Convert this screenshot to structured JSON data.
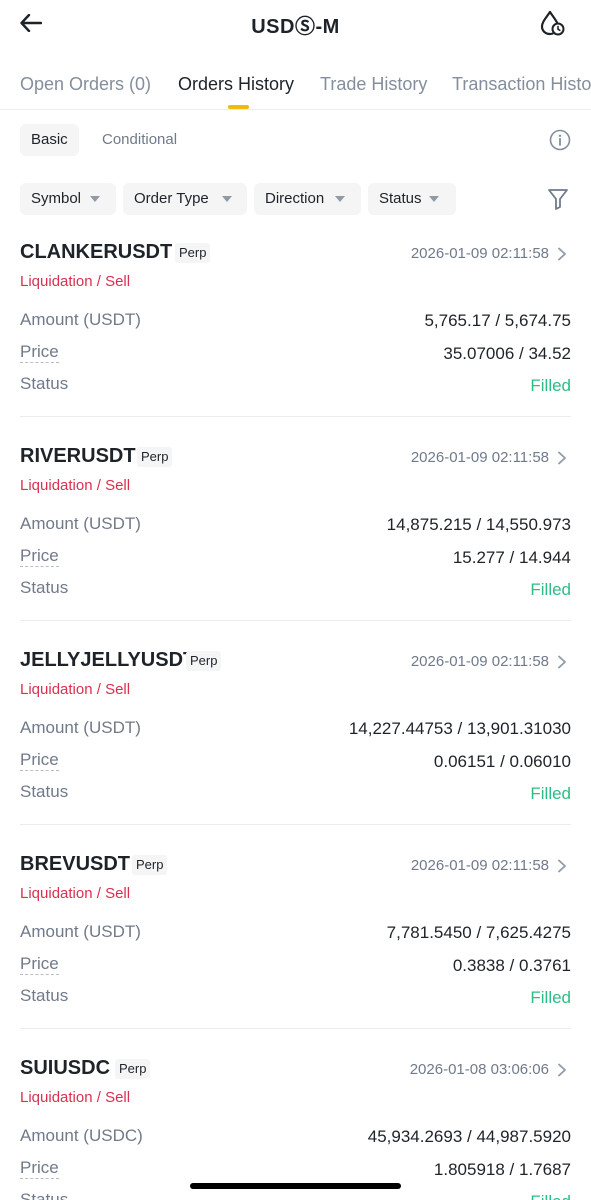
{
  "header": {
    "title": "USDⓈ-M",
    "back_icon": "arrow-left-icon",
    "right_icon": "drop-clock-icon"
  },
  "tabs": [
    {
      "label": "Open Orders (0)",
      "active": false
    },
    {
      "label": "Orders History",
      "active": true
    },
    {
      "label": "Trade History",
      "active": false
    },
    {
      "label": "Transaction History",
      "active": false
    }
  ],
  "subtabs": [
    {
      "label": "Basic",
      "active": true
    },
    {
      "label": "Conditional",
      "active": false
    }
  ],
  "filters": [
    {
      "label": "Symbol"
    },
    {
      "label": "Order Type"
    },
    {
      "label": "Direction"
    },
    {
      "label": "Status"
    }
  ],
  "orders": [
    {
      "symbol": "CLANKERUSDT",
      "badge": "Perp",
      "time": "2026-01-09 02:11:58",
      "type": "Liquidation / Sell",
      "amount_label": "Amount (USDT)",
      "amount": "5,765.17 / 5,674.75",
      "price_label": "Price",
      "price": "35.07006 / 34.52",
      "status_label": "Status",
      "status": "Filled"
    },
    {
      "symbol": "RIVERUSDT",
      "badge": "Perp",
      "time": "2026-01-09 02:11:58",
      "type": "Liquidation / Sell",
      "amount_label": "Amount (USDT)",
      "amount": "14,875.215 / 14,550.973",
      "price_label": "Price",
      "price": "15.277 / 14.944",
      "status_label": "Status",
      "status": "Filled"
    },
    {
      "symbol": "JELLYJELLYUSDT",
      "badge": "Perp",
      "time": "2026-01-09 02:11:58",
      "type": "Liquidation / Sell",
      "amount_label": "Amount (USDT)",
      "amount": "14,227.44753 / 13,901.31030",
      "price_label": "Price",
      "price": "0.06151 / 0.06010",
      "status_label": "Status",
      "status": "Filled"
    },
    {
      "symbol": "BREVUSDT",
      "badge": "Perp",
      "time": "2026-01-09 02:11:58",
      "type": "Liquidation / Sell",
      "amount_label": "Amount (USDT)",
      "amount": "7,781.5450 / 7,625.4275",
      "price_label": "Price",
      "price": "0.3838 / 0.3761",
      "status_label": "Status",
      "status": "Filled"
    },
    {
      "symbol": "SUIUSDC",
      "badge": "Perp",
      "time": "2026-01-08 03:06:06",
      "type": "Liquidation / Sell",
      "amount_label": "Amount (USDC)",
      "amount": "45,934.2693 / 44,987.5920",
      "price_label": "Price",
      "price": "1.805918 / 1.7687",
      "status_label": "Status",
      "status": "Filled"
    }
  ],
  "colors": {
    "accent": "#f0b90b",
    "sell": "#d9304e",
    "filled": "#2ebd85",
    "muted": "#707a8a"
  }
}
